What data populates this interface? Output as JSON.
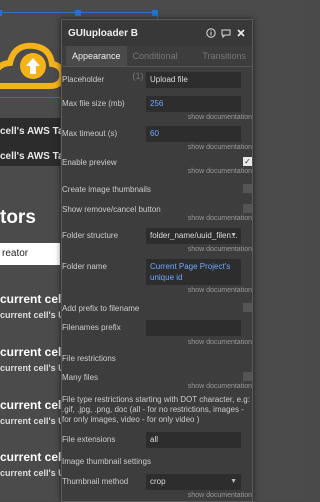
{
  "background": {
    "aws_line_1": "cell's AWS Table's",
    "aws_line_2": "cell's AWS Table's",
    "heading": "tors",
    "input_value": "reator",
    "big_1": "current cell's",
    "small_1": "current cell's Use",
    "big_2": "current cell's",
    "small_2": "current cell's Use",
    "big_3": "current cell's",
    "small_3": "current cell's Use",
    "big_4": "current cell's",
    "small_4": "current cell's Use"
  },
  "panel": {
    "title": "GUIuploader B",
    "tabs": [
      "Appearance",
      "Conditional (1)",
      "Transitions"
    ],
    "show_documentation": "show documentation",
    "placeholder_label": "Placeholder",
    "placeholder_value": "Upload file",
    "max_file_size_label": "Max file size (mb)",
    "max_file_size_value": "256",
    "max_timeout_label": "Max timeout (s)",
    "max_timeout_value": "60",
    "enable_preview_label": "Enable preview",
    "create_thumbnails_label": "Create image thumbnails",
    "show_remove_label": "Show remove/cancel button",
    "folder_structure_label": "Folder structure",
    "folder_structure_value": "folder_name/uuid_filen...",
    "folder_name_label": "Folder name",
    "folder_name_value": "Current Page Project's unique id",
    "add_prefix_label": "Add prefix to filename",
    "filenames_prefix_label": "Filenames prefix",
    "file_restrictions_label": "File restrictions",
    "many_files_label": "Many files",
    "file_type_text": "File type restrictions starting with DOT character, e.g: .gif, .jpg, .png, doc (all - for no restrictions, images - for only images, video - for only video )",
    "file_extensions_label": "File extensions",
    "file_extensions_value": "all",
    "image_thumbnail_settings_label": "Image thumbnail settings",
    "thumbnail_method_label": "Thumbnail method",
    "thumbnail_method_value": "crop"
  }
}
